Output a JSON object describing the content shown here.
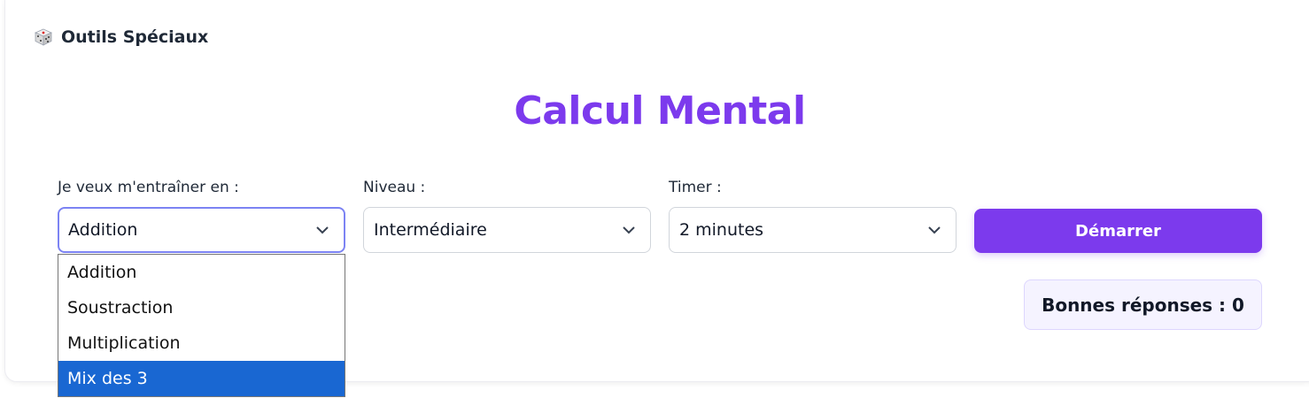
{
  "section": {
    "icon": "dice-icon",
    "title": "Outils Spéciaux"
  },
  "main": {
    "title": "Calcul Mental"
  },
  "operation": {
    "label": "Je veux m'entraîner en :",
    "value": "Addition",
    "options": [
      "Addition",
      "Soustraction",
      "Multiplication",
      "Mix des 3"
    ],
    "highlighted": "Mix des 3"
  },
  "level": {
    "label": "Niveau :",
    "value": "Intermédiaire"
  },
  "timer": {
    "label": "Timer :",
    "value": "2 minutes"
  },
  "start_button": {
    "label": "Démarrer"
  },
  "score": {
    "text": "Bonnes réponses : 0"
  },
  "colors": {
    "accent": "#7c3aed",
    "focus_ring": "#7c83f3",
    "option_highlight": "#1967d2"
  }
}
